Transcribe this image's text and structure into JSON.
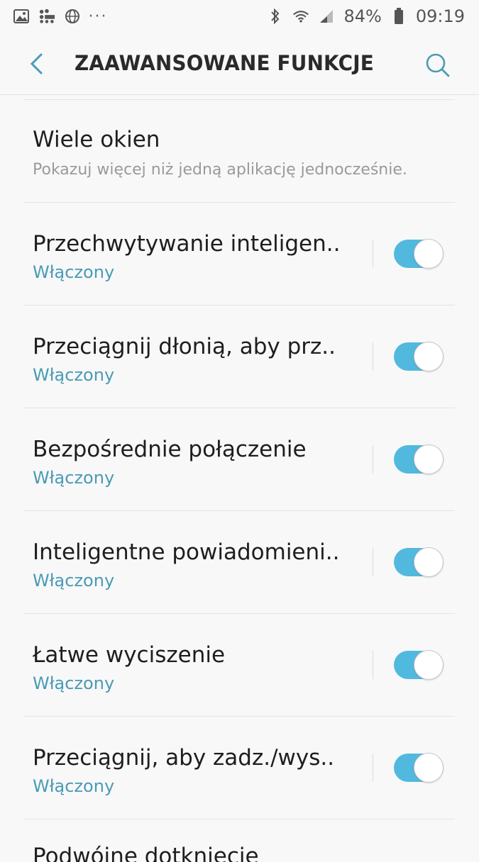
{
  "status_bar": {
    "battery": "84%",
    "time": "09:19",
    "left_icons": [
      "gallery-icon",
      "live-icon",
      "globe-icon",
      "more-dots-icon"
    ],
    "right_icons": [
      "bluetooth-icon",
      "wifi-icon",
      "signal-icon",
      "battery-icon"
    ]
  },
  "header": {
    "title": "ZAAWANSOWANE FUNKCJE",
    "accent": "#4a9bb5"
  },
  "list": {
    "first": {
      "title": "Wiele okien",
      "subtitle": "Pokazuj więcej niż jedną aplikację jednocześnie."
    },
    "items": [
      {
        "title": "Przechwytywanie inteligen..",
        "status": "Włączony",
        "enabled": true
      },
      {
        "title": "Przeciągnij dłonią, aby prz..",
        "status": "Włączony",
        "enabled": true
      },
      {
        "title": "Bezpośrednie połączenie",
        "status": "Włączony",
        "enabled": true
      },
      {
        "title": "Inteligentne powiadomieni..",
        "status": "Włączony",
        "enabled": true
      },
      {
        "title": "Łatwe wyciszenie",
        "status": "Włączony",
        "enabled": true
      },
      {
        "title": "Przeciągnij, aby zadz./wys..",
        "status": "Włączony",
        "enabled": true
      }
    ],
    "partial_title": "Podwójne dotknięcie"
  },
  "colors": {
    "toggle_on": "#52b9de",
    "status_text": "#4a9bb5"
  }
}
